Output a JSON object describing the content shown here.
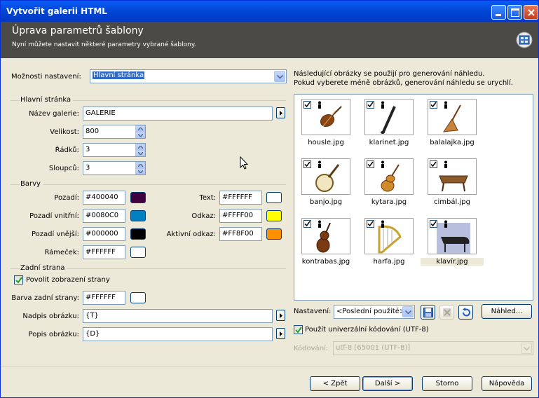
{
  "window": {
    "title": "Vytvořit galerii HTML",
    "header_title": "Úprava parametrů šablony",
    "header_subtitle": "Nyní můžete nastavit některé parametry vybrané šablony."
  },
  "options": {
    "label": "Možnosti nastavení:",
    "selected": "Hlavní stránka"
  },
  "main_page": {
    "group": "Hlavní stránka",
    "gallery_name_label": "Název galerie:",
    "gallery_name": "GALERIE",
    "size_label": "Velikost:",
    "size": "800",
    "rows_label": "Řádků:",
    "rows": "3",
    "cols_label": "Sloupců:",
    "cols": "3"
  },
  "colors": {
    "group": "Barvy",
    "background_label": "Pozadí:",
    "background": "#400040",
    "inner_bg_label": "Pozadí vnitřní:",
    "inner_bg": "#0080C0",
    "outer_bg_label": "Pozadí vnější:",
    "outer_bg": "#000000",
    "frame_label": "Rámeček:",
    "frame": "#FFFFFF",
    "text_label": "Text:",
    "text": "#FFFFFF",
    "link_label": "Odkaz:",
    "link": "#FFFF00",
    "active_link_label": "Aktivní odkaz:",
    "active_link": "#FF8F00",
    "swatch_background": "#400040",
    "swatch_inner": "#0080c0",
    "swatch_outer": "#000000",
    "swatch_frame": "#ffffff",
    "swatch_text": "#ffffff",
    "swatch_link": "#ffff00",
    "swatch_active": "#ff8f00"
  },
  "back_side": {
    "group": "Zadní strana",
    "enable_label": "Povolit zobrazení strany",
    "enable_checked": true,
    "bg_label": "Barva zadní strany:",
    "bg": "#FFFFFF",
    "caption_label": "Nadpis obrázku:",
    "caption": "{T}",
    "desc_label": "Popis obrázku:",
    "desc": "{D}"
  },
  "preview": {
    "info_line1": "Následující obrázky se použijí pro generování náhledu.",
    "info_line2": "Pokud vyberete méně obrázků, generování náhledu se urychlí.",
    "thumbnails": [
      {
        "name": "housle.jpg",
        "checked": true,
        "icon": "violin-icon"
      },
      {
        "name": "klarinet.jpg",
        "checked": true,
        "icon": "clarinet-icon"
      },
      {
        "name": "balalajka.jpg",
        "checked": true,
        "icon": "balalaika-icon"
      },
      {
        "name": "banjo.jpg",
        "checked": true,
        "icon": "banjo-icon"
      },
      {
        "name": "kytara.jpg",
        "checked": true,
        "icon": "guitar-icon"
      },
      {
        "name": "cimbál.jpg",
        "checked": true,
        "icon": "dulcimer-icon"
      },
      {
        "name": "kontrabas.jpg",
        "checked": true,
        "icon": "double-bass-icon"
      },
      {
        "name": "harfa.jpg",
        "checked": true,
        "icon": "harp-icon"
      },
      {
        "name": "klavír.jpg",
        "checked": true,
        "icon": "piano-icon"
      }
    ],
    "settings_label": "Nastavení:",
    "settings_value": "<Poslední použité>",
    "preview_button": "Náhled...",
    "utf8_label": "Použít univerzální kódování (UTF-8)",
    "utf8_checked": true,
    "encoding_label": "Kódování:",
    "encoding_value": "utf-8   [65001 (UTF-8)]"
  },
  "footer": {
    "back": "< Zpět",
    "next": "Další >",
    "cancel": "Storno",
    "help": "Nápověda"
  }
}
